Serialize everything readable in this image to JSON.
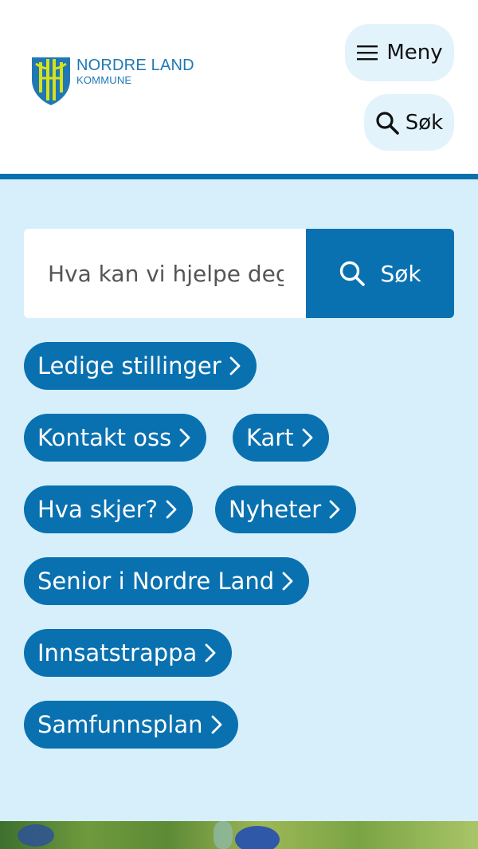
{
  "header": {
    "logo": {
      "name": "NORDRE LAND",
      "sub": "KOMMUNE",
      "colors": {
        "shield": "#1f78b4",
        "emblem": "#d6e21a"
      }
    },
    "menu_label": "Meny",
    "menu_icon": "hamburger-icon",
    "search_label": "Søk",
    "search_icon": "search-icon"
  },
  "search": {
    "placeholder": "Hva kan vi hjelpe deg med?",
    "button_label": "Søk",
    "button_icon": "search-icon"
  },
  "quick_links": [
    {
      "label": "Ledige stillinger"
    },
    {
      "label": "Kontakt oss"
    },
    {
      "label": "Kart"
    },
    {
      "label": "Hva skjer?"
    },
    {
      "label": "Nyheter"
    },
    {
      "label": "Senior i Nordre Land"
    },
    {
      "label": "Innsatstrappa"
    },
    {
      "label": "Samfunnsplan"
    }
  ],
  "colors": {
    "primary": "#0a71b0",
    "background_light": "#d6effb",
    "pill_light": "#e3f3fc"
  }
}
